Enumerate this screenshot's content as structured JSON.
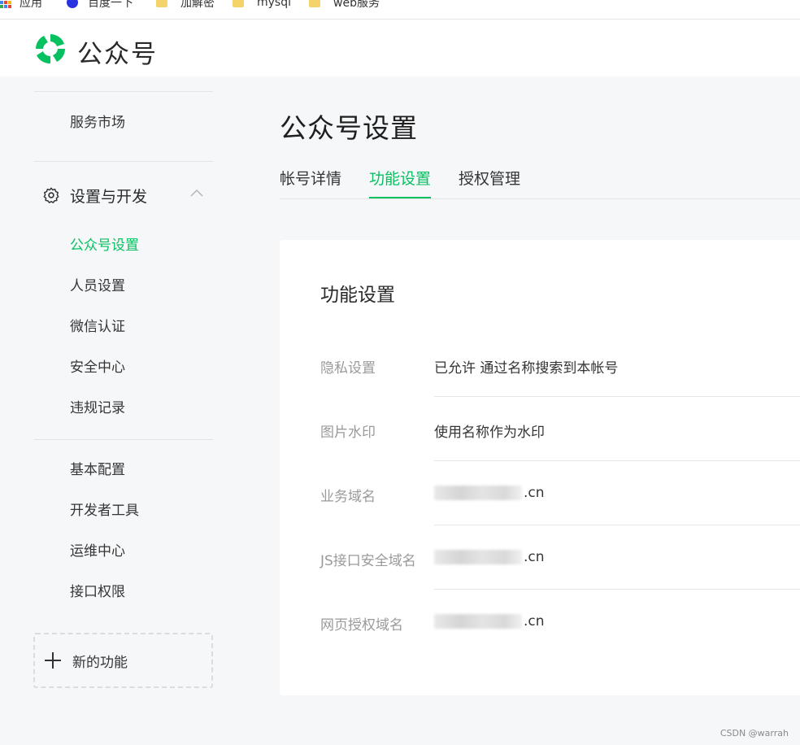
{
  "bookmarks": [
    {
      "label": "应用",
      "icon": "apps-grid-icon"
    },
    {
      "label": "百度一下",
      "icon": "baidu-icon"
    },
    {
      "label": "加解密",
      "icon": "folder-icon"
    },
    {
      "label": "mysql",
      "icon": "folder-icon"
    },
    {
      "label": "web服务",
      "icon": "folder-icon"
    }
  ],
  "header": {
    "brand": "公众号",
    "accent": "#07c160"
  },
  "sidebar": {
    "top_item": "服务市场",
    "group_title": "设置与开发",
    "group_items": [
      "公众号设置",
      "人员设置",
      "微信认证",
      "安全中心",
      "违规记录"
    ],
    "dev_items": [
      "基本配置",
      "开发者工具",
      "运维中心",
      "接口权限"
    ],
    "new_function": "新的功能"
  },
  "main": {
    "title": "公众号设置",
    "tabs": [
      "帐号详情",
      "功能设置",
      "授权管理"
    ],
    "active_tab": "功能设置",
    "card": {
      "title": "功能设置",
      "rows": [
        {
          "label": "隐私设置",
          "value": "已允许 通过名称搜索到本帐号"
        },
        {
          "label": "图片水印",
          "value": "使用名称作为水印"
        },
        {
          "label": "业务域名",
          "value": ".cn"
        },
        {
          "label": "JS接口安全域名",
          "value": ".cn"
        },
        {
          "label": "网页授权域名",
          "value": ".cn"
        }
      ]
    }
  },
  "watermark": "CSDN @warrah"
}
